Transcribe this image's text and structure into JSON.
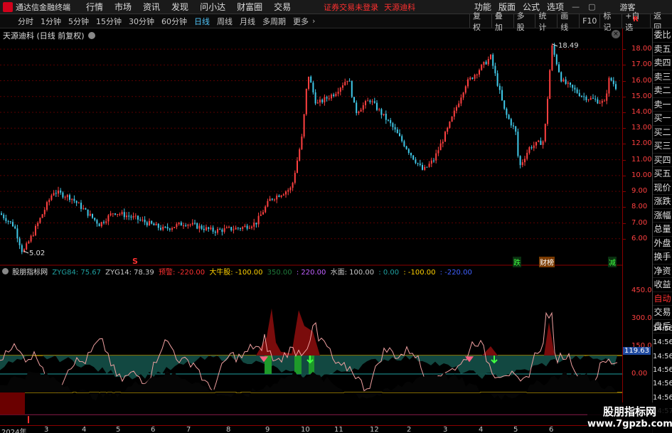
{
  "titlebar": {
    "app_title": "通达信金融终端",
    "menus": [
      "行情",
      "市场",
      "资讯",
      "发现",
      "问小达",
      "财富圈",
      "交易"
    ],
    "notice": "证券交易未登录",
    "stock_name": "天源迪科",
    "right_items": [
      "功能",
      "版面",
      "公式",
      "选项"
    ],
    "user": "游客"
  },
  "toolbar": {
    "periods": [
      "分时",
      "1分钟",
      "5分钟",
      "15分钟",
      "30分钟",
      "60分钟",
      "日线",
      "周线",
      "月线",
      "多周期",
      "更多"
    ],
    "active_period": "日线",
    "right_buttons": [
      "复权",
      "叠加",
      "多股",
      "统计",
      "画线",
      "F10",
      "标记",
      "+自选",
      "返回"
    ]
  },
  "main_chart": {
    "legend": "天源迪科 (日线 前复权)",
    "high_label": "18.49",
    "low_label": "5.02",
    "y_ticks": [
      "18.00",
      "17.00",
      "16.00",
      "15.00",
      "14.00",
      "13.00",
      "12.00",
      "11.00",
      "10.00",
      "9.00",
      "8.00",
      "7.00",
      "6.00"
    ],
    "markers": [
      "跌",
      "财榜",
      "减",
      "S"
    ]
  },
  "indicator": {
    "name": "股朋指标网",
    "legend": [
      {
        "text": "ZYG84: 75.67",
        "color": "#c8c8c8"
      },
      {
        "text": "ZYG14: 78.39",
        "color": "#c8c8c8"
      },
      {
        "text": "预警: -220.00",
        "color": "#ff3030"
      },
      {
        "text": "大牛股: -100.00",
        "color": "#ffd000"
      },
      {
        "text": "350.00",
        "color": "#1f7a3a"
      },
      {
        "text": ": 220.00",
        "color": "#c060ff"
      },
      {
        "text": "水面: 100.00",
        "color": "#c8c8c8"
      },
      {
        "text": ": 0.00",
        "color": "#1fa0a0"
      },
      {
        "text": ": -100.00",
        "color": "#ffd000"
      },
      {
        "text": ": -220.00",
        "color": "#4060ff"
      }
    ],
    "y_ticks": [
      "450.0",
      "300.0",
      "150.0",
      "0.00"
    ],
    "current_value": "119.63",
    "time_ticks": [
      "14:56",
      "14:56",
      "14:56",
      "14:56",
      "14:56",
      "14:56",
      "14:57"
    ]
  },
  "x_axis": [
    "2024年",
    "3",
    "4",
    "5",
    "6",
    "7",
    "8",
    "9",
    "10",
    "11",
    "12",
    "2",
    "3",
    "4",
    "5",
    "6"
  ],
  "sidebar": [
    "委比",
    "卖五",
    "卖四",
    "卖三",
    "卖二",
    "卖一",
    "买一",
    "买二",
    "买三",
    "买四",
    "买五",
    "现价",
    "涨跌",
    "涨幅",
    "总量",
    "外盘",
    "换手",
    "净资",
    "收益",
    "自动",
    "交易",
    "盘后"
  ],
  "watermark": {
    "title": "股朋指标网",
    "url": "www.7gpzb.com"
  },
  "colors": {
    "up": "#ff4040",
    "down": "#40c8e8",
    "axis": "#8b0000",
    "legend_hl": "#4fc3f7"
  },
  "icons": [
    "close-icon",
    "chevron-right-icon",
    "gear-icon"
  ]
}
